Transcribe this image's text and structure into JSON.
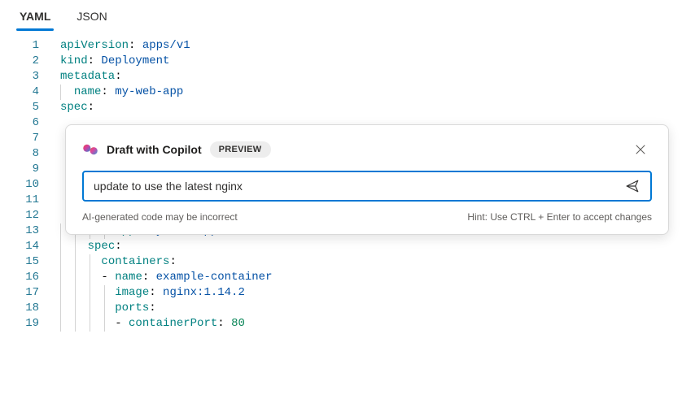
{
  "tabs": {
    "yaml": "YAML",
    "json": "JSON"
  },
  "code": {
    "lines": [
      {
        "n": "1",
        "tokens": [
          {
            "c": "k",
            "t": "apiVersion"
          },
          {
            "c": "p",
            "t": ": "
          },
          {
            "c": "v",
            "t": "apps/v1"
          }
        ]
      },
      {
        "n": "2",
        "tokens": [
          {
            "c": "k",
            "t": "kind"
          },
          {
            "c": "p",
            "t": ": "
          },
          {
            "c": "v",
            "t": "Deployment"
          }
        ]
      },
      {
        "n": "3",
        "tokens": [
          {
            "c": "k",
            "t": "metadata"
          },
          {
            "c": "p",
            "t": ":"
          }
        ]
      },
      {
        "n": "4",
        "indent": 1,
        "tokens": [
          {
            "c": "k",
            "t": "name"
          },
          {
            "c": "p",
            "t": ": "
          },
          {
            "c": "v",
            "t": "my-web-app"
          }
        ]
      },
      {
        "n": "5",
        "tokens": [
          {
            "c": "k",
            "t": "spec"
          },
          {
            "c": "p",
            "t": ":"
          }
        ]
      },
      {
        "n": "6",
        "tokens": []
      },
      {
        "n": "7",
        "tokens": []
      },
      {
        "n": "8",
        "tokens": []
      },
      {
        "n": "9",
        "tokens": []
      },
      {
        "n": "10",
        "tokens": []
      },
      {
        "n": "11",
        "tokens": []
      },
      {
        "n": "12",
        "tokens": []
      },
      {
        "n": "13",
        "indent": 4,
        "tokens": [
          {
            "c": "k",
            "t": "app"
          },
          {
            "c": "p",
            "t": ": "
          },
          {
            "c": "v",
            "t": "my-web-app"
          }
        ]
      },
      {
        "n": "14",
        "indent": 2,
        "tokens": [
          {
            "c": "k",
            "t": "spec"
          },
          {
            "c": "p",
            "t": ":"
          }
        ]
      },
      {
        "n": "15",
        "indent": 3,
        "tokens": [
          {
            "c": "k",
            "t": "containers"
          },
          {
            "c": "p",
            "t": ":"
          }
        ]
      },
      {
        "n": "16",
        "indent": 3,
        "tokens": [
          {
            "c": "d",
            "t": "- "
          },
          {
            "c": "k",
            "t": "name"
          },
          {
            "c": "p",
            "t": ": "
          },
          {
            "c": "v",
            "t": "example-container"
          }
        ]
      },
      {
        "n": "17",
        "indent": 4,
        "tokens": [
          {
            "c": "k",
            "t": "image"
          },
          {
            "c": "p",
            "t": ": "
          },
          {
            "c": "v",
            "t": "nginx:1.14.2"
          }
        ]
      },
      {
        "n": "18",
        "indent": 4,
        "tokens": [
          {
            "c": "k",
            "t": "ports"
          },
          {
            "c": "p",
            "t": ":"
          }
        ]
      },
      {
        "n": "19",
        "indent": 4,
        "tokens": [
          {
            "c": "d",
            "t": "- "
          },
          {
            "c": "k",
            "t": "containerPort"
          },
          {
            "c": "p",
            "t": ": "
          },
          {
            "c": "n",
            "t": "80"
          }
        ]
      }
    ]
  },
  "dialog": {
    "title": "Draft with Copilot",
    "badge": "PREVIEW",
    "input_value": "update to use the latest nginx",
    "disclaimer": "AI-generated code may be incorrect",
    "hint": "Hint: Use CTRL + Enter to accept changes"
  }
}
